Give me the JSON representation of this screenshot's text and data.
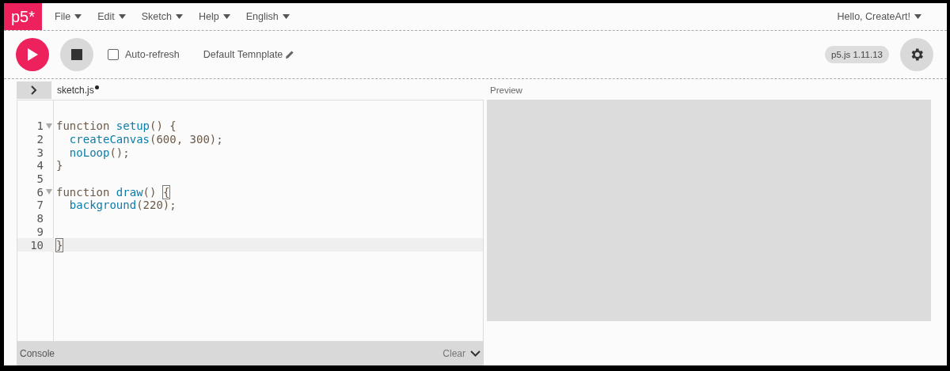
{
  "logo": "p5*",
  "menu": [
    {
      "label": "File"
    },
    {
      "label": "Edit"
    },
    {
      "label": "Sketch"
    },
    {
      "label": "Help"
    },
    {
      "label": "English"
    }
  ],
  "user_menu": {
    "label": "Hello, CreateArt!"
  },
  "toolbar": {
    "auto_refresh": {
      "label": "Auto-refresh",
      "checked": false
    },
    "sketch_name": "Default Temnplate",
    "version": "p5.js 1.11.13"
  },
  "editor": {
    "sidebar_toggle": {
      "expanded": false
    },
    "tab": {
      "label": "sketch.js",
      "unsaved": true
    },
    "lines": [
      {
        "number": "1",
        "foldable": true,
        "selected": false,
        "tokens": [
          {
            "kind": "keyword",
            "text": "function "
          },
          {
            "kind": "call",
            "text": "setup"
          },
          {
            "kind": "plain",
            "text": "() {"
          }
        ]
      },
      {
        "number": "2",
        "foldable": false,
        "selected": false,
        "tokens": [
          {
            "kind": "call",
            "text": "  createCanvas"
          },
          {
            "kind": "plain",
            "text": "(600, 300);"
          }
        ]
      },
      {
        "number": "3",
        "foldable": false,
        "selected": false,
        "tokens": [
          {
            "kind": "call",
            "text": "  noLoop"
          },
          {
            "kind": "plain",
            "text": "();"
          }
        ]
      },
      {
        "number": "4",
        "foldable": false,
        "selected": false,
        "tokens": [
          {
            "kind": "plain",
            "text": "}"
          }
        ]
      },
      {
        "number": "5",
        "foldable": false,
        "selected": false
      },
      {
        "number": "6",
        "foldable": true,
        "selected": false,
        "tokens": [
          {
            "kind": "keyword",
            "text": "function "
          },
          {
            "kind": "call",
            "text": "draw"
          },
          {
            "kind": "plain",
            "text": "() "
          },
          {
            "kind": "match",
            "text": "{"
          }
        ]
      },
      {
        "number": "7",
        "foldable": false,
        "selected": false,
        "tokens": [
          {
            "kind": "call",
            "text": "  background"
          },
          {
            "kind": "plain",
            "text": "(220);"
          }
        ]
      },
      {
        "number": "8",
        "foldable": false,
        "selected": false
      },
      {
        "number": "9",
        "foldable": false,
        "selected": false
      },
      {
        "number": "10",
        "foldable": false,
        "selected": true,
        "tokens": [
          {
            "kind": "match",
            "text": "}"
          }
        ]
      }
    ]
  },
  "preview": {
    "label": "Preview"
  },
  "console": {
    "label": "Console",
    "clear": "Clear"
  }
}
